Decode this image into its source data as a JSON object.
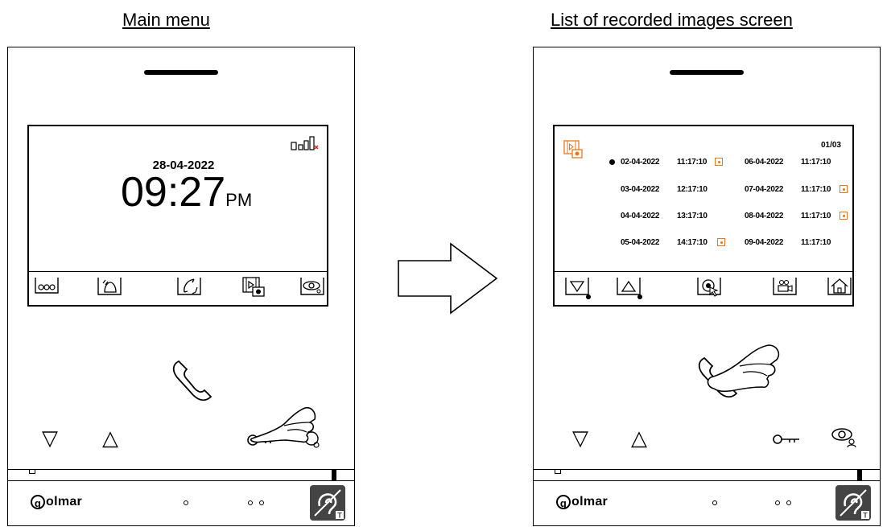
{
  "titles": {
    "left": "Main menu",
    "right": "List of recorded images screen"
  },
  "main_menu": {
    "date": "28-04-2022",
    "time": "09:27",
    "ampm": "PM",
    "softkeys": [
      "intercom-icon",
      "doorbell-icon",
      "call-icon",
      "recorded-images-icon",
      "monitor-icon"
    ]
  },
  "recorded_list": {
    "page": "01/03",
    "columns": [
      [
        {
          "date": "02-04-2022",
          "time": "11:17:10",
          "camera": true,
          "selected": true
        },
        {
          "date": "03-04-2022",
          "time": "12:17:10",
          "camera": false,
          "selected": false
        },
        {
          "date": "04-04-2022",
          "time": "13:17:10",
          "camera": false,
          "selected": false
        },
        {
          "date": "05-04-2022",
          "time": "14:17:10",
          "camera": true,
          "selected": false
        }
      ],
      [
        {
          "date": "06-04-2022",
          "time": "11:17:10",
          "camera": false
        },
        {
          "date": "07-04-2022",
          "time": "11:17:10",
          "camera": true
        },
        {
          "date": "08-04-2022",
          "time": "11:17:10",
          "camera": true
        },
        {
          "date": "09-04-2022",
          "time": "11:17:10",
          "camera": false
        }
      ]
    ],
    "softkeys": [
      "down-icon",
      "up-icon",
      "select-icon",
      "video-icon",
      "home-icon"
    ]
  },
  "device": {
    "brand": "olmar",
    "brand_initial": "g",
    "buttons": {
      "down": "▽",
      "up": "△"
    }
  },
  "colors": {
    "accent": "#e8761e",
    "signal_cross": "#e02020",
    "hand_fill": "#ffffff"
  }
}
